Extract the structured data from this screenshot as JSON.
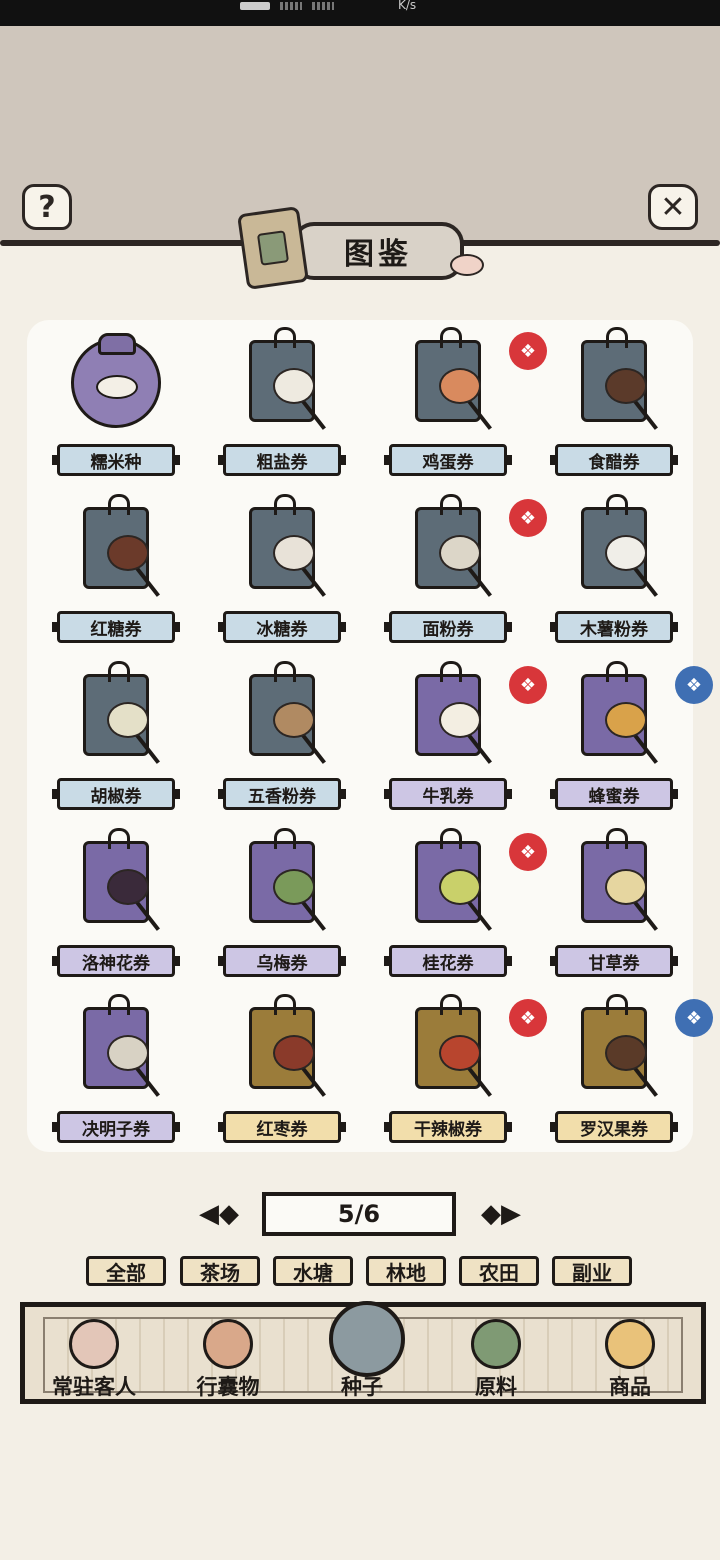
{
  "status_bar": {
    "speed": "K/s"
  },
  "header": {
    "title": "图鉴",
    "help_icon": "question-mark-icon",
    "close_icon": "close-x-icon"
  },
  "items": [
    {
      "label": "糯米种",
      "tag": "pouch",
      "stamp": null
    },
    {
      "label": "粗盐券",
      "tag": "slate",
      "stamp": null
    },
    {
      "label": "鸡蛋券",
      "tag": "slate",
      "stamp": "red"
    },
    {
      "label": "食醋券",
      "tag": "slate",
      "stamp": null
    },
    {
      "label": "红糖券",
      "tag": "slate",
      "stamp": null
    },
    {
      "label": "冰糖券",
      "tag": "slate",
      "stamp": null
    },
    {
      "label": "面粉券",
      "tag": "slate",
      "stamp": "red"
    },
    {
      "label": "木薯粉券",
      "tag": "slate",
      "stamp": null
    },
    {
      "label": "胡椒券",
      "tag": "slate",
      "stamp": null
    },
    {
      "label": "五香粉券",
      "tag": "slate",
      "stamp": null
    },
    {
      "label": "牛乳券",
      "tag": "purple",
      "stamp": "red"
    },
    {
      "label": "蜂蜜券",
      "tag": "purple",
      "stamp": "blue"
    },
    {
      "label": "洛神花券",
      "tag": "purple",
      "stamp": null
    },
    {
      "label": "乌梅券",
      "tag": "purple",
      "stamp": null
    },
    {
      "label": "桂花券",
      "tag": "purple",
      "stamp": "red"
    },
    {
      "label": "甘草券",
      "tag": "purple",
      "stamp": null
    },
    {
      "label": "决明子券",
      "tag": "purple",
      "stamp": null
    },
    {
      "label": "红枣券",
      "tag": "gold",
      "stamp": null
    },
    {
      "label": "干辣椒券",
      "tag": "gold",
      "stamp": "red"
    },
    {
      "label": "罗汉果券",
      "tag": "gold",
      "stamp": "blue"
    }
  ],
  "pager": {
    "text": "5/6"
  },
  "categories": [
    {
      "label": "全部",
      "active": true
    },
    {
      "label": "茶场",
      "active": false
    },
    {
      "label": "水塘",
      "active": false
    },
    {
      "label": "林地",
      "active": false
    },
    {
      "label": "农田",
      "active": false
    },
    {
      "label": "副业",
      "active": false
    }
  ],
  "bottom_nav": [
    {
      "label": "常驻客人",
      "icon": "guest-girl-icon",
      "active": false
    },
    {
      "label": "行囊物",
      "icon": "clothing-icon",
      "active": false
    },
    {
      "label": "种子",
      "icon": "seed-bag-icon",
      "active": true
    },
    {
      "label": "原料",
      "icon": "leaf-icon",
      "active": false
    },
    {
      "label": "商品",
      "icon": "pastry-box-icon",
      "active": false
    }
  ],
  "colors": {
    "tag_slate": "#5d6c77",
    "tag_purple": "#7a6aa6",
    "tag_gold": "#9b7c3a",
    "label_slate": "#c9dbe6",
    "label_purple": "#cdc6e4",
    "label_gold": "#f2deab",
    "stamp_red": "#d8363a",
    "stamp_blue": "#3f6fb3"
  }
}
